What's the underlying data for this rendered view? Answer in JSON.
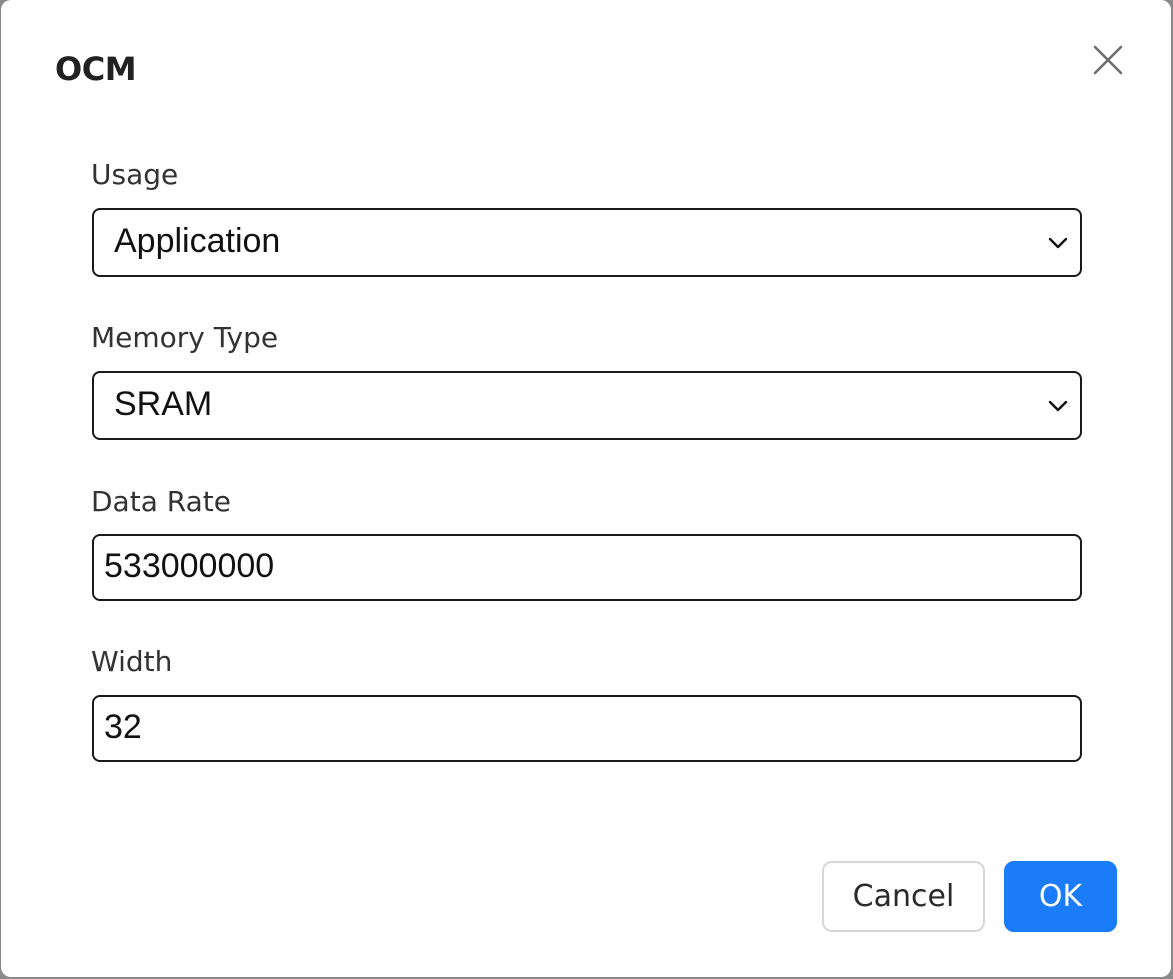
{
  "dialog": {
    "title": "OCM"
  },
  "fields": {
    "usage": {
      "label": "Usage",
      "value": "Application"
    },
    "memory_type": {
      "label": "Memory Type",
      "value": "SRAM"
    },
    "data_rate": {
      "label": "Data Rate",
      "value": "533000000"
    },
    "width": {
      "label": "Width",
      "value": "32"
    }
  },
  "buttons": {
    "cancel": "Cancel",
    "ok": "OK"
  },
  "icons": {
    "close": "close-icon",
    "dropdown": "chevron-down-icon"
  },
  "colors": {
    "primary": "#1a7cf8",
    "border": "#1a1a1a"
  }
}
